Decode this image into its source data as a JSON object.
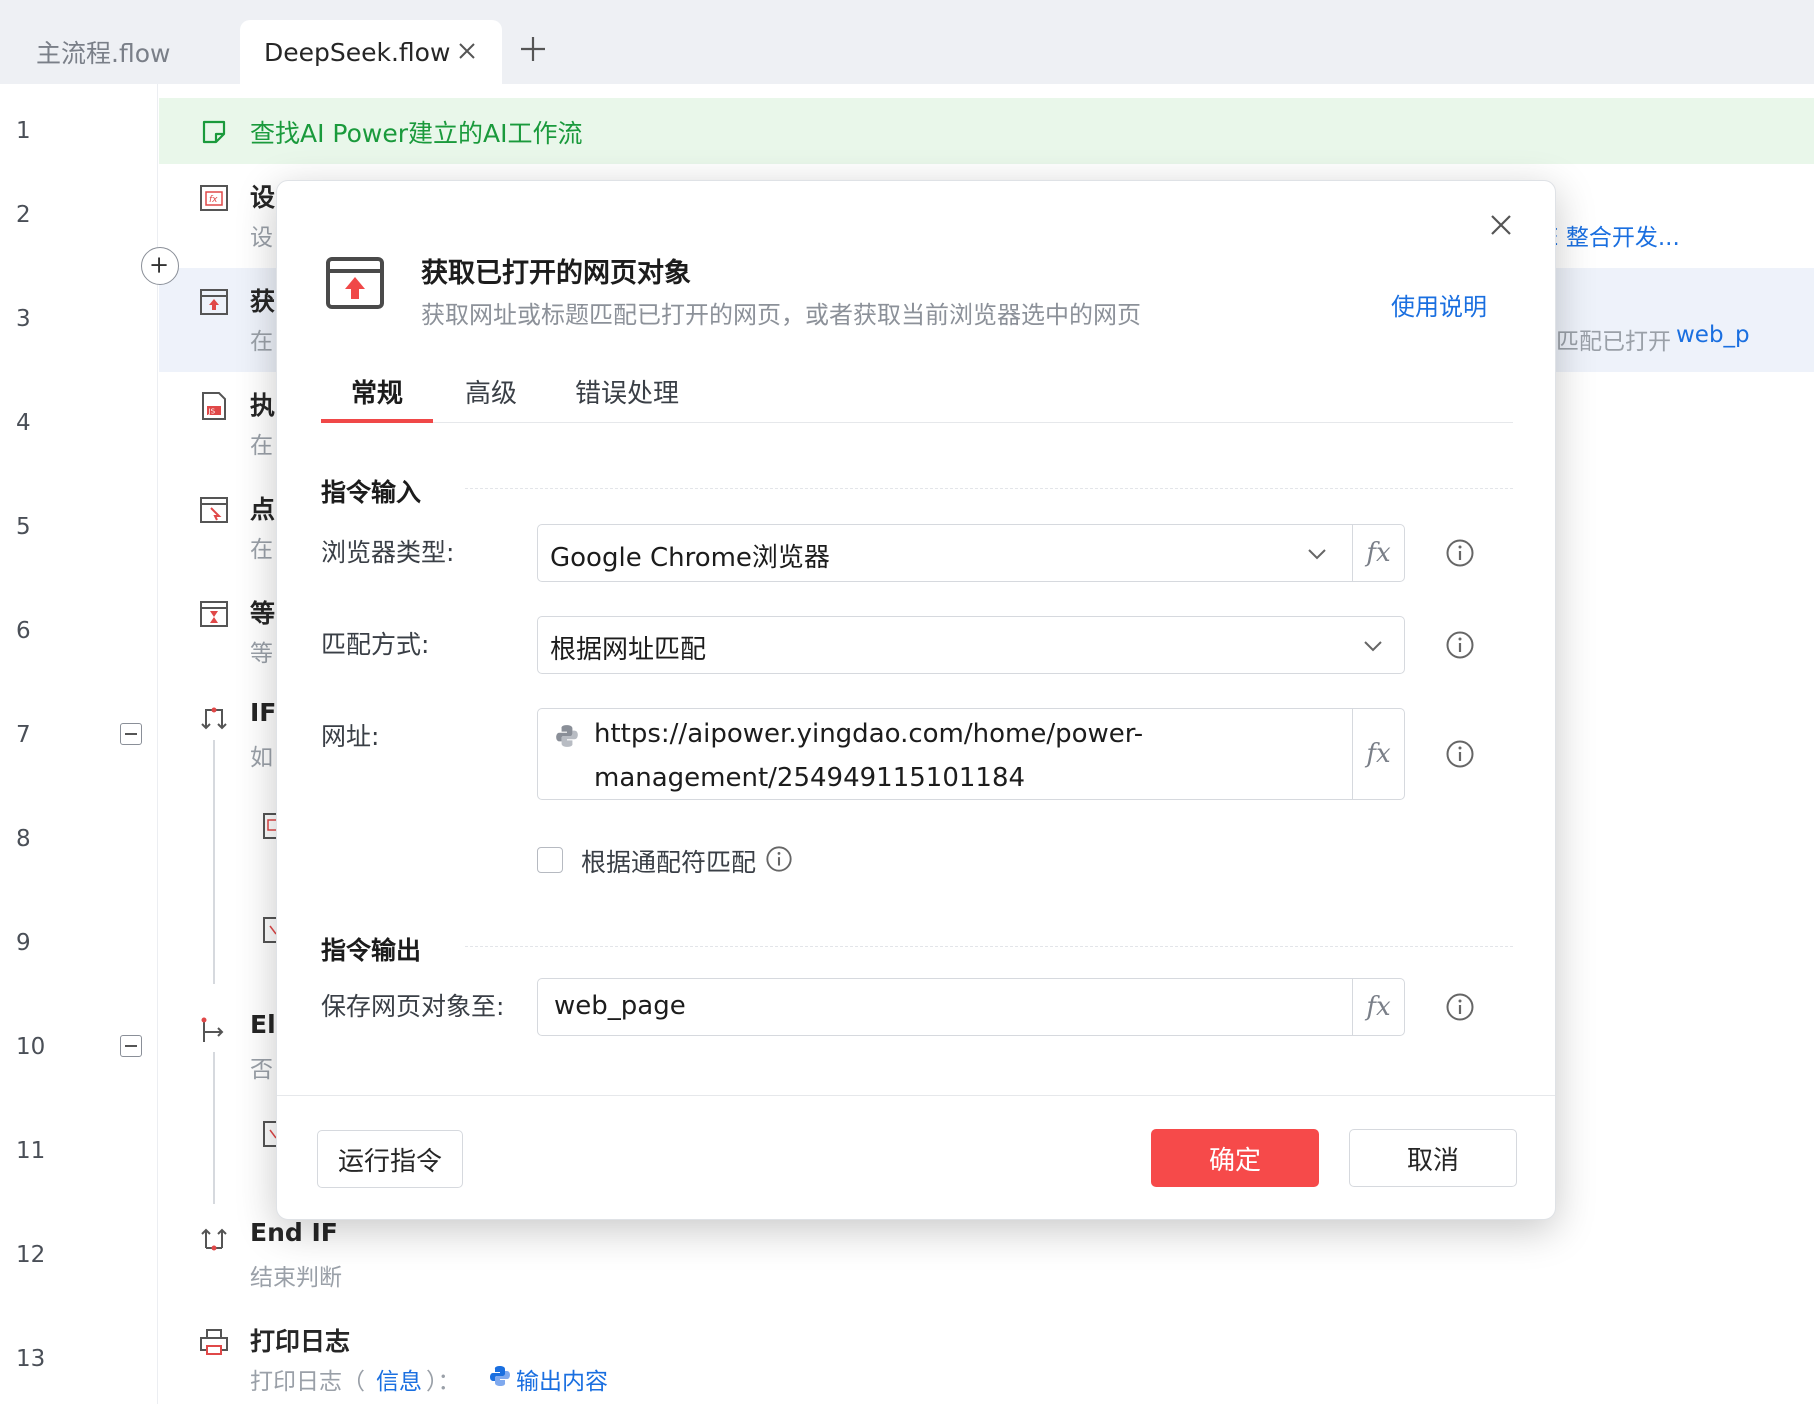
{
  "tabs": {
    "items": [
      {
        "label": "主流程.flow",
        "active": false
      },
      {
        "label": "DeepSeek.flow",
        "active": true
      }
    ]
  },
  "gutter": {
    "line_numbers": [
      "1",
      "2",
      "3",
      "4",
      "5",
      "6",
      "7",
      "8",
      "9",
      "10",
      "11",
      "12",
      "13"
    ]
  },
  "flow": {
    "comment": "查找AI Power建立的AI工作流",
    "row2": {
      "title": "设",
      "sub": "设",
      "right_text": "E 整合开发..."
    },
    "row3": {
      "title": "获",
      "sub": "在",
      "right_text": "匹配已打开",
      "right_var": "web_p"
    },
    "row4": {
      "title": "执",
      "sub": "在"
    },
    "row5": {
      "title": "点",
      "sub": "在"
    },
    "row6": {
      "title": "等",
      "sub": "等"
    },
    "row7": {
      "title": "IF",
      "sub": "如"
    },
    "row10": {
      "title": "El",
      "sub": "否"
    },
    "row12": {
      "title": "End IF",
      "sub": "结束判断"
    },
    "row13": {
      "title": "打印日志",
      "sub_prefix": "打印日志（",
      "sub_link": "信息",
      "sub_mid": "）：",
      "sub_output": "输出内容"
    }
  },
  "modal": {
    "title": "获取已打开的网页对象",
    "description": "获取网址或标题匹配已打开的网页，或者获取当前浏览器选中的网页",
    "help_link": "使用说明",
    "tabs": [
      "常规",
      "高级",
      "错误处理"
    ],
    "section_input": "指令输入",
    "browser_type_label": "浏览器类型:",
    "browser_type_value": "Google Chrome浏览器",
    "match_mode_label": "匹配方式:",
    "match_mode_value": "根据网址匹配",
    "url_label": "网址:",
    "url_value_line1": "https://aipower.yingdao.com/home/power-",
    "url_value_line2": "management/254949115101184",
    "wildcard_label": "根据通配符匹配",
    "wildcard_checked": false,
    "section_output": "指令输出",
    "save_label": "保存网页对象至:",
    "save_value": "web_page",
    "fx_label": "fx",
    "btn_run": "运行指令",
    "btn_ok": "确定",
    "btn_cancel": "取消"
  },
  "colors": {
    "accent_red": "#f64a4a",
    "link_blue": "#1a6fe0",
    "comment_green": "#1a9a3c",
    "comment_bg": "#e9f7ea",
    "selected_bg": "#eef2fa"
  }
}
